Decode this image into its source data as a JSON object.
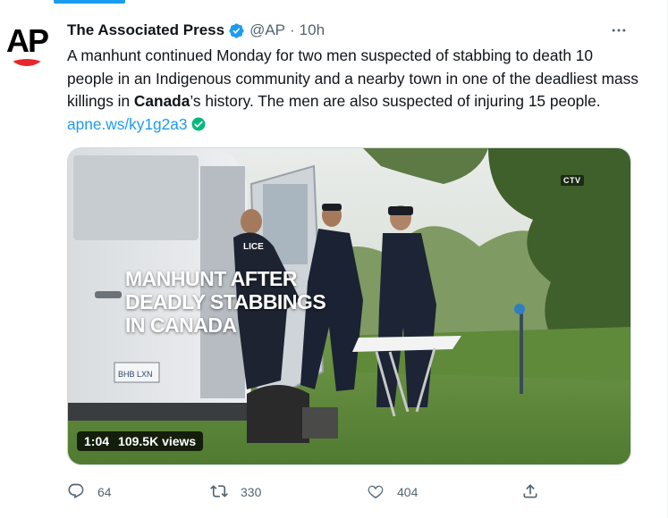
{
  "tweet": {
    "author_name": "The Associated Press",
    "avatar_text": "AP",
    "handle": "@AP",
    "separator": "·",
    "time": "10h",
    "text_part1": "A manhunt continued Monday for two men suspected of stabbing to death 10 people in an Indigenous community and a nearby town in one of the deadliest mass killings in ",
    "text_bold": "Canada",
    "text_part2": "’s history. The men are also suspected of injuring 15 people. ",
    "link": "apne.ws/ky1g2a3"
  },
  "media": {
    "overlay_lines": [
      "MANHUNT AFTER",
      "DEADLY STABBINGS",
      "IN CANADA"
    ],
    "badge": "CTV",
    "police_label": "LICE",
    "plate_text": "BHB LXN",
    "duration": "1:04",
    "views": "109.5K views"
  },
  "actions": {
    "reply_count": "64",
    "retweet_count": "330",
    "like_count": "404"
  },
  "icons": {
    "verified": "verified-badge-icon",
    "more": "more-icon",
    "reply": "reply-icon",
    "retweet": "retweet-icon",
    "like": "like-icon",
    "share": "share-icon",
    "link_check": "green-check-icon"
  },
  "colors": {
    "accent": "#1d9bf0",
    "text": "#0f1419",
    "secondary": "#536471",
    "ap_red": "#e8262a",
    "link_check": "#00ba7c"
  }
}
